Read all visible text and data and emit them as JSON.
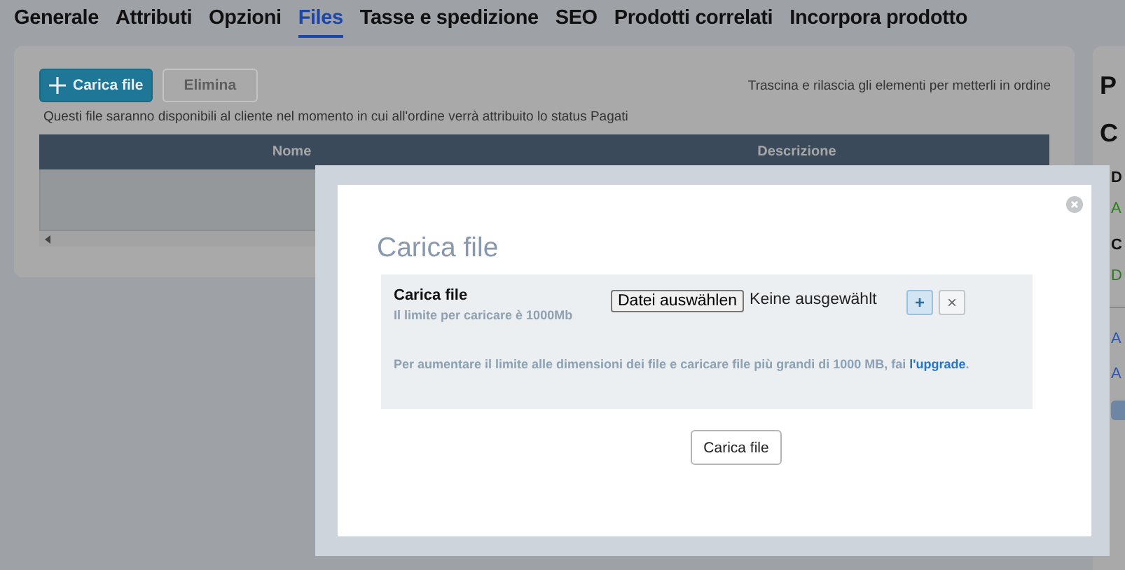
{
  "tabs": [
    {
      "label": "Generale",
      "selected": false
    },
    {
      "label": "Attributi",
      "selected": false
    },
    {
      "label": "Opzioni",
      "selected": false
    },
    {
      "label": "Files",
      "selected": true
    },
    {
      "label": "Tasse e spedizione",
      "selected": false
    },
    {
      "label": "SEO",
      "selected": false
    },
    {
      "label": "Prodotti correlati",
      "selected": false
    },
    {
      "label": "Incorpora prodotto",
      "selected": false
    }
  ],
  "files_card": {
    "upload_button": "Carica file",
    "delete_button": {
      "label": "Elimina",
      "disabled": true
    },
    "hint": "Trascina e rilascia gli elementi per metterli in ordine",
    "info": "Questi file saranno disponibili al cliente nel momento in cui all'ordine verrà attribuito lo status Pagati",
    "table": {
      "columns": [
        "Nome",
        "Descrizione"
      ]
    }
  },
  "side_panel": {
    "items": [
      {
        "kind": "heading",
        "text": "P"
      },
      {
        "kind": "heading",
        "text": "C"
      },
      {
        "kind": "label",
        "text": "D"
      },
      {
        "kind": "value",
        "text": "A"
      },
      {
        "kind": "label",
        "text": "C"
      },
      {
        "kind": "value",
        "text": "D"
      },
      {
        "kind": "divider"
      },
      {
        "kind": "link",
        "text": "A"
      },
      {
        "kind": "link",
        "text": "A"
      },
      {
        "kind": "button"
      }
    ]
  },
  "modal": {
    "title": "Carica file",
    "field_label": "Carica file",
    "limit": "Il limite per caricare è 1000Mb",
    "file_button": "Datei auswählen",
    "file_status": "Keine ausgewählt",
    "add_button": "+",
    "remove_button": "×",
    "note": "Per aumentare il limite alle dimensioni dei file e caricare file più grandi di 1000 MB, fai",
    "note_link": "l'upgrade",
    "note_end": ".",
    "submit_button": "Carica file"
  }
}
